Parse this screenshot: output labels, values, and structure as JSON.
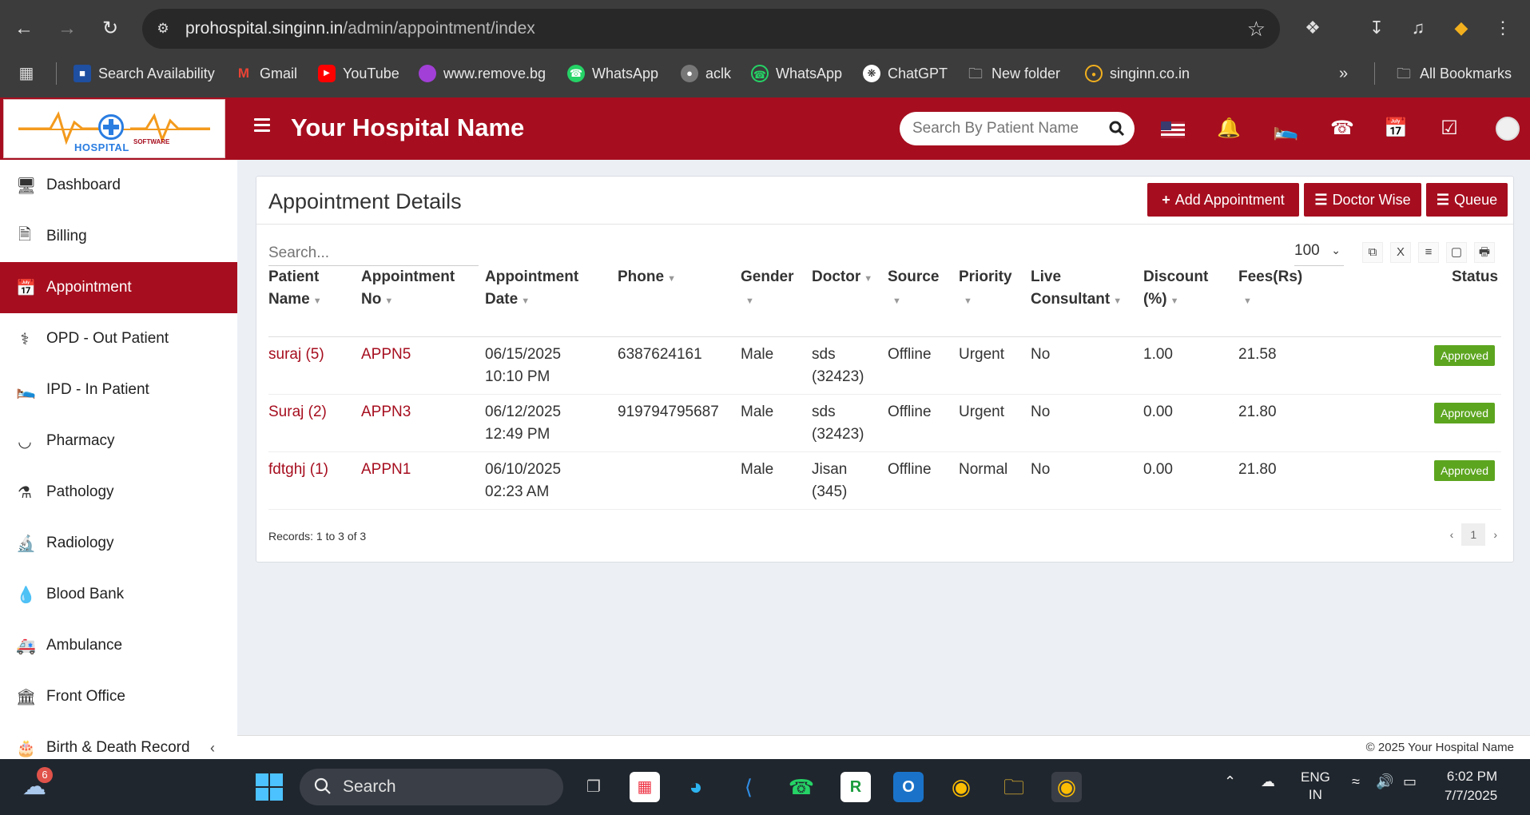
{
  "browser": {
    "url_host": "prohospital.singinn.in",
    "url_path": "/admin/appointment/index",
    "bookmarks": [
      {
        "label": "Search Availability",
        "icon": "site-icon"
      },
      {
        "label": "Gmail",
        "icon": "gmail-icon"
      },
      {
        "label": "YouTube",
        "icon": "youtube-icon"
      },
      {
        "label": "www.remove.bg",
        "icon": "removebg-icon"
      },
      {
        "label": "WhatsApp",
        "icon": "whatsapp-icon"
      },
      {
        "label": "aclk",
        "icon": "globe-icon"
      },
      {
        "label": "WhatsApp",
        "icon": "whatsapp-icon"
      },
      {
        "label": "ChatGPT",
        "icon": "chatgpt-icon"
      },
      {
        "label": "New folder",
        "icon": "folder-icon"
      },
      {
        "label": "singinn.co.in",
        "icon": "singinn-icon"
      }
    ],
    "all_bookmarks": "All Bookmarks"
  },
  "header": {
    "title": "Your Hospital Name",
    "search_placeholder": "Search By Patient Name",
    "logo_text": "HOSPITAL",
    "logo_sub": "SOFTWARE"
  },
  "sidebar": {
    "items": [
      {
        "label": "Dashboard",
        "icon": "monitor-icon"
      },
      {
        "label": "Billing",
        "icon": "billing-icon"
      },
      {
        "label": "Appointment",
        "icon": "calendar-check-icon"
      },
      {
        "label": "OPD - Out Patient",
        "icon": "stethoscope-icon"
      },
      {
        "label": "IPD - In Patient",
        "icon": "bed-icon"
      },
      {
        "label": "Pharmacy",
        "icon": "mortar-icon"
      },
      {
        "label": "Pathology",
        "icon": "flask-icon"
      },
      {
        "label": "Radiology",
        "icon": "microscope-icon"
      },
      {
        "label": "Blood Bank",
        "icon": "drop-icon"
      },
      {
        "label": "Ambulance",
        "icon": "ambulance-icon"
      },
      {
        "label": "Front Office",
        "icon": "building-icon"
      },
      {
        "label": "Birth & Death Record",
        "icon": "birthday-icon"
      }
    ]
  },
  "main": {
    "title": "Appointment Details",
    "buttons": {
      "add": "Add Appointment",
      "doctor_wise": "Doctor Wise",
      "queue": "Queue"
    },
    "search_placeholder": "Search...",
    "page_length": "100",
    "columns": [
      [
        "Patient",
        "Name"
      ],
      [
        "Appointment",
        "No"
      ],
      [
        "Appointment",
        "Date"
      ],
      [
        "Phone",
        ""
      ],
      [
        "Gender",
        ""
      ],
      [
        "Doctor",
        ""
      ],
      [
        "Source",
        ""
      ],
      [
        "Priority",
        ""
      ],
      [
        "Live",
        "Consultant"
      ],
      [
        "Discount",
        "(%)"
      ],
      [
        "Fees(Rs)",
        ""
      ],
      [
        "Status",
        ""
      ]
    ],
    "rows": [
      {
        "patient": "suraj (5)",
        "appt_no": "APPN5",
        "date": "06/15/2025",
        "time": "10:10 PM",
        "phone": "6387624161",
        "gender": "Male",
        "doctor": "sds",
        "doctor_id": "(32423)",
        "source": "Offline",
        "priority": "Urgent",
        "live": "No",
        "discount": "1.00",
        "fees": "21.58",
        "status": "Approved"
      },
      {
        "patient": "Suraj (2)",
        "appt_no": "APPN3",
        "date": "06/12/2025",
        "time": "12:49 PM",
        "phone": "919794795687",
        "gender": "Male",
        "doctor": "sds",
        "doctor_id": "(32423)",
        "source": "Offline",
        "priority": "Urgent",
        "live": "No",
        "discount": "0.00",
        "fees": "21.80",
        "status": "Approved"
      },
      {
        "patient": "fdtghj (1)",
        "appt_no": "APPN1",
        "date": "06/10/2025",
        "time": "02:23 AM",
        "phone": "",
        "gender": "Male",
        "doctor": "Jisan",
        "doctor_id": "(345)",
        "source": "Offline",
        "priority": "Normal",
        "live": "No",
        "discount": "0.00",
        "fees": "21.80",
        "status": "Approved"
      }
    ],
    "records_text": "Records: 1 to 3 of 3",
    "current_page": "1"
  },
  "footer": {
    "text": "© 2025 Your Hospital Name"
  },
  "taskbar": {
    "weather_badge": "6",
    "search_label": "Search",
    "lang_top": "ENG",
    "lang_bottom": "IN",
    "time": "6:02 PM",
    "date": "7/7/2025"
  },
  "colors": {
    "brand": "#a60e1f",
    "approved": "#5ca51f"
  }
}
